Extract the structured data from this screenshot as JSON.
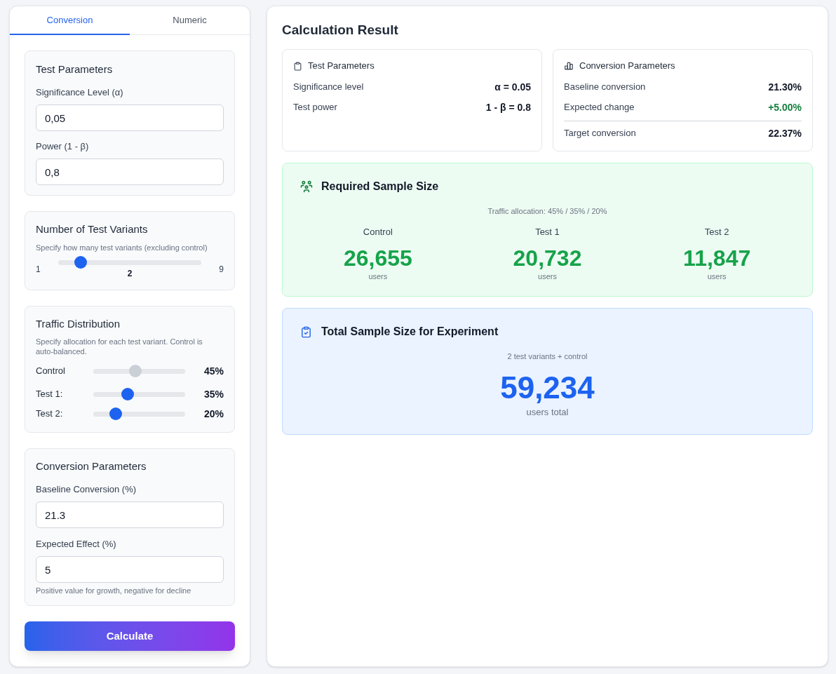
{
  "tabs": [
    {
      "label": "Conversion",
      "selected": true
    },
    {
      "label": "Numeric",
      "selected": false
    }
  ],
  "test_parameters": {
    "title": "Test Parameters",
    "fields": [
      {
        "label": "Significance Level (α)",
        "value": "0,05"
      },
      {
        "label": "Power (1 - β)",
        "value": "0,8"
      }
    ]
  },
  "test_variants": {
    "title": "Number of Test Variants",
    "hint": "Specify how many test variants (excluding control)",
    "min_label": "1",
    "max_label": "9",
    "value": "2",
    "level": 0.125
  },
  "traffic_distribution": {
    "title": "Traffic Distribution",
    "hint": "Specify allocation for each test variant. Control is auto-balanced.",
    "rows": [
      {
        "label": "Control",
        "level": 0.45,
        "reading": "45%",
        "disabled": true
      },
      {
        "label": "Test 1:",
        "level": 0.35,
        "reading": "35%",
        "disabled": false
      },
      {
        "label": "Test 2:",
        "level": 0.2,
        "reading": "20%",
        "disabled": false
      }
    ]
  },
  "conversion_parameters": {
    "title": "Conversion Parameters",
    "fields": [
      {
        "label": "Baseline Conversion (%)",
        "value": "21.3"
      },
      {
        "label": "Expected Effect (%)",
        "value": "5"
      }
    ],
    "hint": "Positive value for growth, negative for decline"
  },
  "calculate_button": {
    "label": "Calculate"
  },
  "result": {
    "title": "Calculation Result",
    "test_parameters": {
      "title": "Test Parameters",
      "rows": [
        {
          "label": "Significance level",
          "value": "α = 0.05"
        },
        {
          "label": "Test power",
          "value": "1 - β = 0.8"
        }
      ]
    },
    "conversion_parameters": {
      "title": "Conversion Parameters",
      "rows": [
        {
          "kind": "plain",
          "label": "Baseline conversion",
          "value": "21.30%"
        },
        {
          "kind": "change",
          "label": "Expected change",
          "value": "+5.00%"
        },
        {
          "kind": "total",
          "label": "Target conversion",
          "value": "22.37%"
        }
      ]
    },
    "required_sample_size": {
      "title": "Required Sample Size",
      "allocation": "Traffic allocation: 45% / 35% / 20%",
      "groups": [
        {
          "name": "Control",
          "count": "26,655",
          "unit": "users"
        },
        {
          "name": "Test 1",
          "count": "20,732",
          "unit": "users"
        },
        {
          "name": "Test 2",
          "count": "11,847",
          "unit": "users"
        }
      ]
    },
    "total_sample_size": {
      "title": "Total Sample Size for Experiment",
      "note": "2 test variants + control",
      "count": "59,234",
      "unit": "users total"
    }
  }
}
